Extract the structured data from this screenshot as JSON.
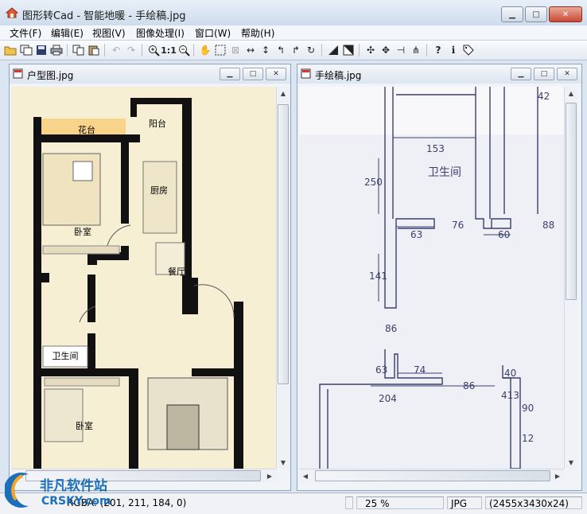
{
  "app": {
    "title": "图形转Cad - 智能地暖 - 手绘稿.jpg"
  },
  "window_controls": {
    "minimize": "▁",
    "maximize": "□",
    "close": "✕"
  },
  "menu": [
    {
      "label": "文件(F)"
    },
    {
      "label": "编辑(E)"
    },
    {
      "label": "视图(V)"
    },
    {
      "label": "图像处理(I)"
    },
    {
      "label": "窗口(W)"
    },
    {
      "label": "帮助(H)"
    }
  ],
  "toolbar": {
    "zoom_actual": "1:1",
    "help": "?",
    "info": "i"
  },
  "doc_left": {
    "title": "户型图.jpg",
    "labels": {
      "huatai": "花台",
      "yangtai": "阳台",
      "chufang": "厨房",
      "woshi1": "卧室",
      "canting": "餐厅",
      "weishengjian": "卫生间",
      "woshi2": "卧室"
    }
  },
  "doc_right": {
    "title": "手绘稿.jpg",
    "sketch": {
      "room_label": "卫生间",
      "dims": [
        "42",
        "153",
        "250",
        "76",
        "63",
        "60",
        "88",
        "141",
        "86",
        "63",
        "74",
        "204",
        "86",
        "40",
        "413",
        "90",
        "12"
      ]
    }
  },
  "status": {
    "pixel_info": "RGBA: (201, 211, 184, 0)",
    "zoom": "25 %",
    "format": "JPG",
    "size": "(2455x3430x24)"
  },
  "watermark": {
    "text_cn": "非凡软件站",
    "text_en": "CRSKY.com"
  },
  "colors": {
    "accent": "#1c6fb8",
    "floor": "#f7efd3",
    "wall": "#111111",
    "huatai_fill": "#f7d48a",
    "paper": "#f3f3f8",
    "pencil": "#3b3f6a"
  }
}
